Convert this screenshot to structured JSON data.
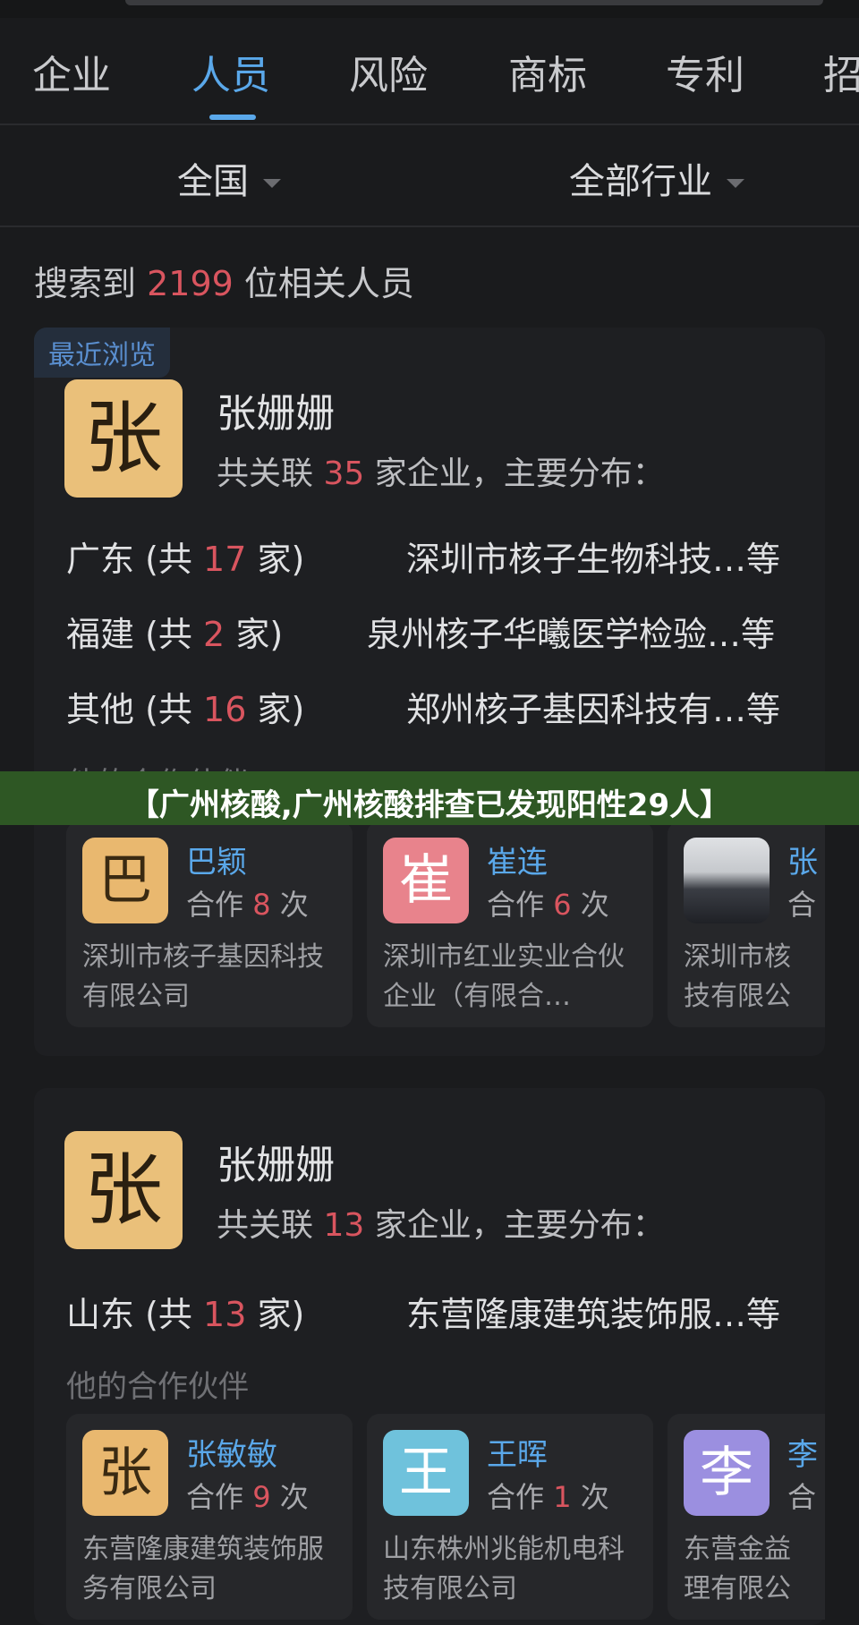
{
  "tabs": [
    {
      "label": "企业"
    },
    {
      "label": "人员"
    },
    {
      "label": "风险"
    },
    {
      "label": "商标"
    },
    {
      "label": "专利"
    },
    {
      "label": "招"
    }
  ],
  "filters": {
    "region": "全国",
    "industry": "全部行业"
  },
  "summary": {
    "prefix": "搜索到",
    "count": "2199",
    "suffix": "位相关人员"
  },
  "banner": "【广州核酸,广州核酸排查已发现阳性29人】",
  "results": [
    {
      "recent_tag": "最近浏览",
      "avatar": "张",
      "name": "张姗姗",
      "assoc_prefix": "共关联",
      "assoc_count": "35",
      "assoc_suffix": "家企业，主要分布：",
      "regions": [
        {
          "region": "广东",
          "open": "(共",
          "count": "17",
          "close": "家)",
          "company": "深圳市核子生物科技…等"
        },
        {
          "region": "福建",
          "open": "(共",
          "count": "2",
          "close": "家)",
          "company": "泉州核子华曦医学检验…等"
        },
        {
          "region": "其他",
          "open": "(共",
          "count": "16",
          "close": "家)",
          "company": "郑州核子基因科技有…等"
        }
      ],
      "partners_label": "他的合作伙伴",
      "partners": [
        {
          "avatar": "巴",
          "avatar_color": "#e9b86f",
          "name": "巴颖",
          "coop_prefix": "合作",
          "coop_count": "8",
          "coop_suffix": "次",
          "company": "深圳市核子基因科技有限公司"
        },
        {
          "avatar": "崔",
          "avatar_color": "#e8838c",
          "name": "崔连",
          "coop_prefix": "合作",
          "coop_count": "6",
          "coop_suffix": "次",
          "company": "深圳市红业实业合伙企业（有限合…"
        },
        {
          "avatar": "",
          "avatar_color": "photo",
          "name": "张",
          "coop_prefix": "合",
          "coop_count": "",
          "coop_suffix": "",
          "company": "深圳市核技有限公"
        }
      ]
    },
    {
      "avatar": "张",
      "name": "张姗姗",
      "assoc_prefix": "共关联",
      "assoc_count": "13",
      "assoc_suffix": "家企业，主要分布：",
      "regions": [
        {
          "region": "山东",
          "open": "(共",
          "count": "13",
          "close": "家)",
          "company": "东营隆康建筑装饰服…等"
        }
      ],
      "partners_label": "他的合作伙伴",
      "partners": [
        {
          "avatar": "张",
          "avatar_color": "#e9b86f",
          "name": "张敏敏",
          "coop_prefix": "合作",
          "coop_count": "9",
          "coop_suffix": "次",
          "company": "东营隆康建筑装饰服务有限公司"
        },
        {
          "avatar": "王",
          "avatar_color": "#6fc2dc",
          "name": "王晖",
          "coop_prefix": "合作",
          "coop_count": "1",
          "coop_suffix": "次",
          "company": "山东株州兆能机电科技有限公司"
        },
        {
          "avatar": "李",
          "avatar_color": "#9b8fe0",
          "name": "李",
          "coop_prefix": "合",
          "coop_count": "",
          "coop_suffix": "",
          "company": "东营金益理有限公"
        }
      ]
    }
  ]
}
